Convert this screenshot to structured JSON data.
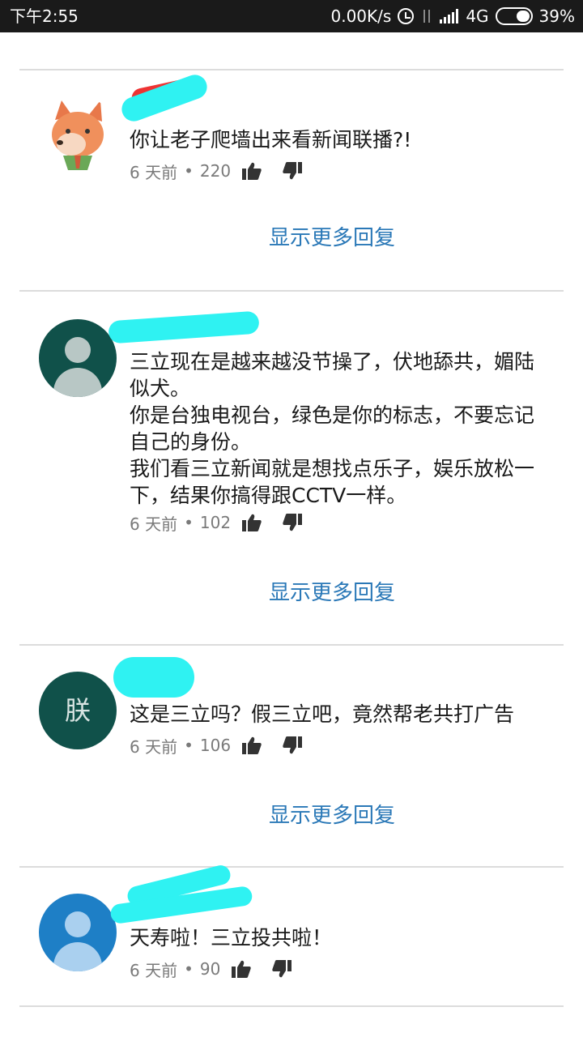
{
  "status_bar": {
    "time": "下午2:55",
    "network_speed": "0.00K/s",
    "network_type": "4G",
    "battery": "39%",
    "icons": [
      "alarm-icon",
      "data-arrows-icon",
      "signal-icon",
      "battery-icon"
    ]
  },
  "comments": [
    {
      "avatar": "fox-avatar",
      "text": "你让老子爬墙出来看新闻联播?!",
      "time": "6 天前",
      "likes": "220"
    },
    {
      "avatar": "default-avatar",
      "text": "三立现在是越来越没节操了，伏地舔共，媚陆似犬。\n你是台独电视台，绿色是你的标志，不要忘记自己的身份。\n我们看三立新闻就是想找点乐子，娱乐放松一下，结果你搞得跟CCTV一样。",
      "time": "6 天前",
      "likes": "102"
    },
    {
      "avatar": "letter-avatar",
      "avatar_letter": "朕",
      "text": "这是三立吗？假三立吧，竟然帮老共打广告",
      "time": "6 天前",
      "likes": "106"
    },
    {
      "avatar": "default-avatar-blue",
      "text": "天寿啦！三立投共啦！",
      "time": "6 天前",
      "likes": "90"
    }
  ],
  "show_more_label": "显示更多回复",
  "colors": {
    "status_bar_bg": "#1a1a1a",
    "link_blue": "#2a78b7",
    "avatar_green": "#10514a",
    "avatar_blue": "#1e7fc6",
    "redaction_cyan": "#2ff2f2"
  }
}
